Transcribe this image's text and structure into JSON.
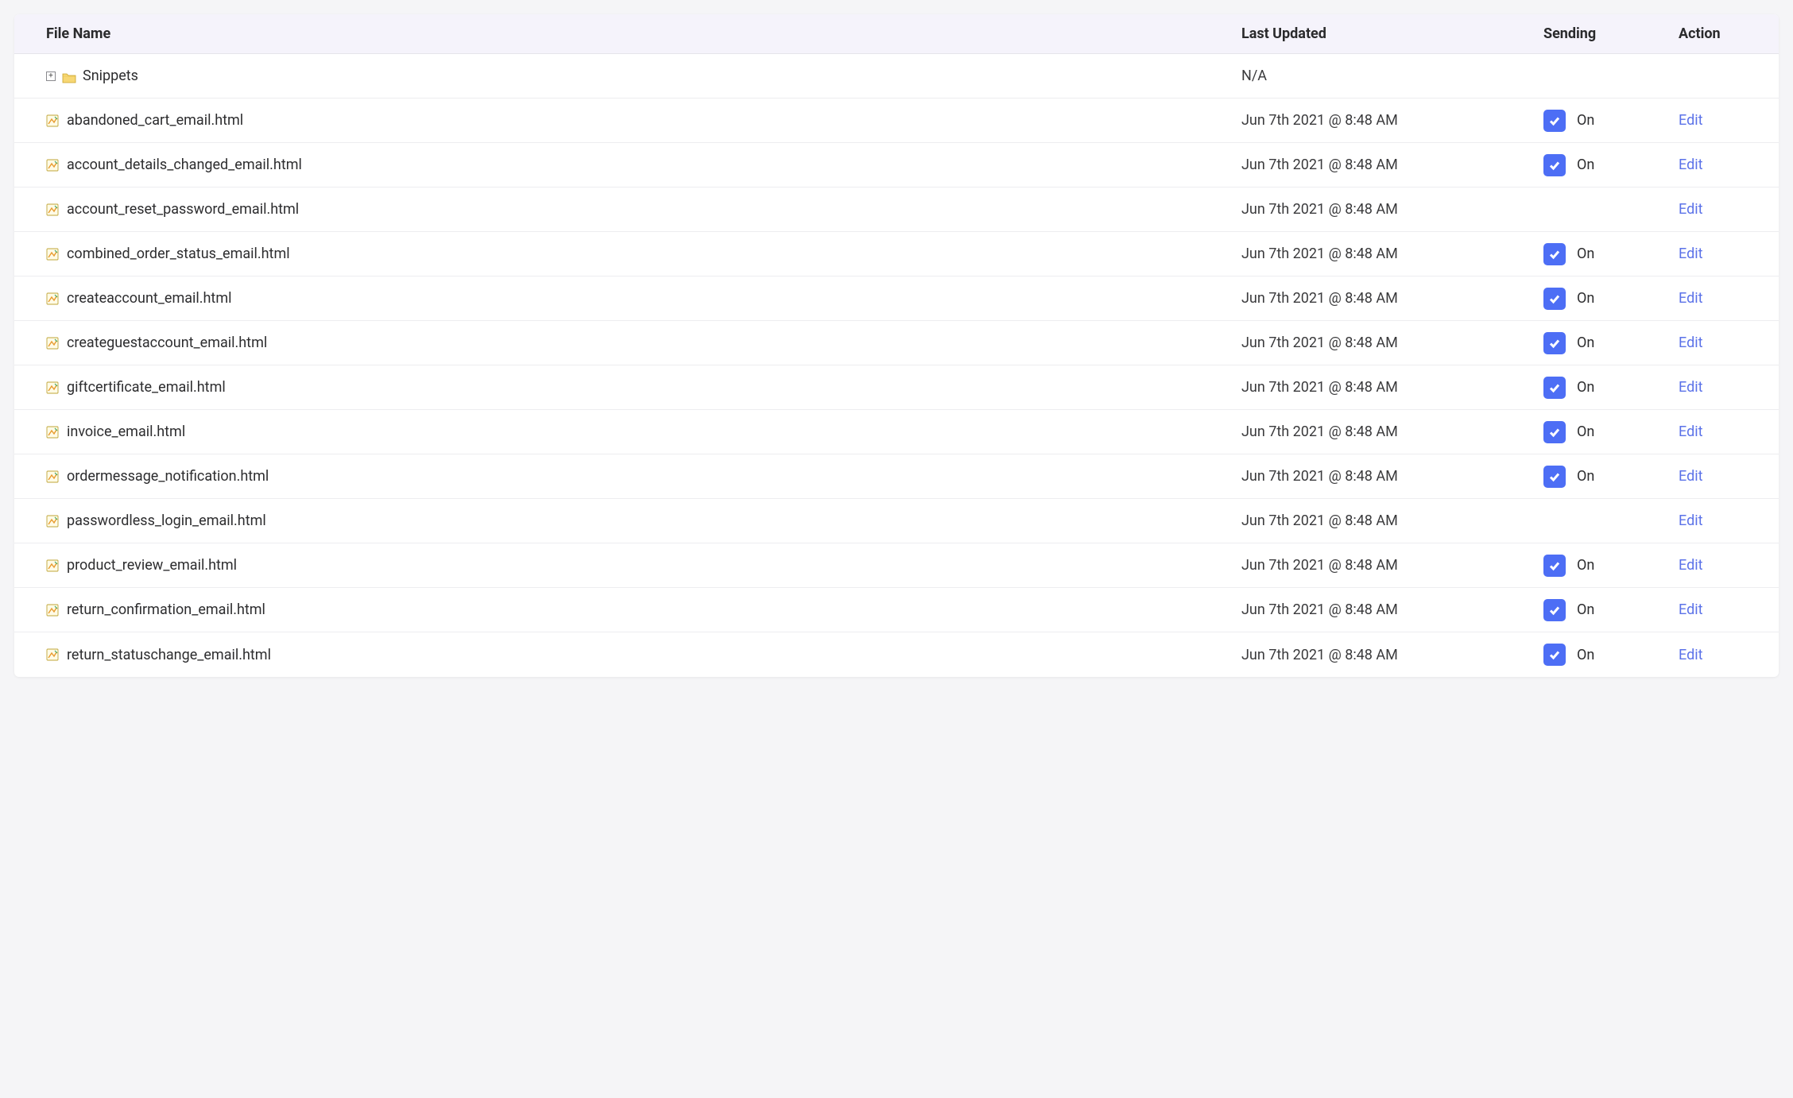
{
  "columns": {
    "filename": "File Name",
    "updated": "Last Updated",
    "sending": "Sending",
    "action": "Action"
  },
  "folder": {
    "name": "Snippets",
    "updated": "N/A"
  },
  "sending_on_label": "On",
  "edit_label": "Edit",
  "rows": [
    {
      "name": "abandoned_cart_email.html",
      "updated": "Jun 7th 2021 @ 8:48 AM",
      "sending": true
    },
    {
      "name": "account_details_changed_email.html",
      "updated": "Jun 7th 2021 @ 8:48 AM",
      "sending": true
    },
    {
      "name": "account_reset_password_email.html",
      "updated": "Jun 7th 2021 @ 8:48 AM",
      "sending": false
    },
    {
      "name": "combined_order_status_email.html",
      "updated": "Jun 7th 2021 @ 8:48 AM",
      "sending": true
    },
    {
      "name": "createaccount_email.html",
      "updated": "Jun 7th 2021 @ 8:48 AM",
      "sending": true
    },
    {
      "name": "createguestaccount_email.html",
      "updated": "Jun 7th 2021 @ 8:48 AM",
      "sending": true
    },
    {
      "name": "giftcertificate_email.html",
      "updated": "Jun 7th 2021 @ 8:48 AM",
      "sending": true
    },
    {
      "name": "invoice_email.html",
      "updated": "Jun 7th 2021 @ 8:48 AM",
      "sending": true
    },
    {
      "name": "ordermessage_notification.html",
      "updated": "Jun 7th 2021 @ 8:48 AM",
      "sending": true
    },
    {
      "name": "passwordless_login_email.html",
      "updated": "Jun 7th 2021 @ 8:48 AM",
      "sending": false
    },
    {
      "name": "product_review_email.html",
      "updated": "Jun 7th 2021 @ 8:48 AM",
      "sending": true
    },
    {
      "name": "return_confirmation_email.html",
      "updated": "Jun 7th 2021 @ 8:48 AM",
      "sending": true
    },
    {
      "name": "return_statuschange_email.html",
      "updated": "Jun 7th 2021 @ 8:48 AM",
      "sending": true
    }
  ]
}
